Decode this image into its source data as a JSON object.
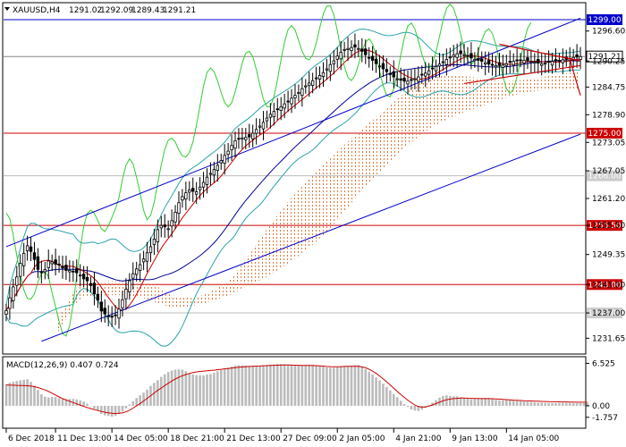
{
  "chart_data": {
    "type": "candlestick",
    "symbol": "XAUUSD,H4",
    "ohlc_header": {
      "open": "1291.02",
      "high": "1292.09",
      "low": "1289.43",
      "close": "1291.21"
    },
    "price_axis": {
      "ylim": [
        1228.5,
        1302.4
      ],
      "tick_labels": [
        "1296.60",
        "1290.25",
        "1284.75",
        "1278.90",
        "1273.05",
        "1267.05",
        "1261.20",
        "1255.50",
        "1249.35",
        "1243.00",
        "1237.00",
        "1231.65"
      ],
      "tick_values": [
        1296.6,
        1290.25,
        1284.75,
        1278.9,
        1273.05,
        1267.05,
        1261.2,
        1255.5,
        1249.35,
        1243.0,
        1237.0,
        1231.65
      ]
    },
    "x_axis": {
      "tick_labels": [
        "6 Dec 2018",
        "11 Dec 13:00",
        "14 Dec 05:00",
        "18 Dec 21:00",
        "21 Dec 13:00",
        "27 Dec 09:00",
        "2 Jan 05:00",
        "4 Jan 21:00",
        "9 Jan 13:00",
        "14 Jan 05:00"
      ],
      "tick_bar_index": [
        0,
        14,
        30,
        46,
        62,
        78,
        94,
        110,
        126,
        142
      ]
    },
    "levels": [
      {
        "label": "1299.00",
        "value": 1299.0,
        "color": "#0000cc",
        "style": "solid"
      },
      {
        "label": "1291.21",
        "value": 1291.21,
        "color": "#888888",
        "style": "solid"
      },
      {
        "label": "1275.00",
        "value": 1275.0,
        "color": "#cc0000",
        "style": "solid"
      },
      {
        "label": "1266.00",
        "value": 1266.0,
        "color": "#bbbbbb",
        "style": "solid"
      },
      {
        "label": "1255.50",
        "value": 1255.5,
        "color": "#cc0000",
        "style": "solid"
      },
      {
        "label": "1243.00",
        "value": 1243.0,
        "color": "#cc0000",
        "style": "solid"
      },
      {
        "label": "1237.00",
        "value": 1237.0,
        "color": "#bbbbbb",
        "style": "solid"
      }
    ],
    "channel": {
      "color": "#0000cc",
      "upper": {
        "x": [
          0,
          163
        ],
        "y": [
          1251.0,
          1299.3
        ]
      },
      "lower": {
        "x": [
          10,
          163
        ],
        "y": [
          1231.0,
          1274.8
        ]
      }
    },
    "triangle": {
      "color": "#cc0000",
      "upper": {
        "x": [
          140,
          163
        ],
        "y": [
          1293.8,
          1290.3
        ]
      },
      "lower": {
        "x": [
          130,
          163
        ],
        "y": [
          1285.5,
          1289.3
        ]
      },
      "projection": {
        "x": [
          160,
          163
        ],
        "y": [
          1290.6,
          1283.0
        ]
      }
    },
    "candles": {
      "count": 164,
      "up_color": "#000000",
      "down_color": "#000000",
      "close": [
        1237.5,
        1240.2,
        1242.5,
        1244.6,
        1247.5,
        1249.6,
        1251.2,
        1250.0,
        1248.3,
        1246.2,
        1245.6,
        1246.2,
        1248.0,
        1247.8,
        1247.3,
        1247.3,
        1246.5,
        1246.0,
        1246.0,
        1245.8,
        1245.5,
        1245.0,
        1244.2,
        1243.8,
        1242.8,
        1241.0,
        1239.7,
        1237.4,
        1236.8,
        1236.4,
        1236.1,
        1236.5,
        1237.8,
        1239.8,
        1242.0,
        1243.8,
        1245.3,
        1246.3,
        1247.2,
        1248.4,
        1249.7,
        1251.0,
        1252.6,
        1254.6,
        1255.5,
        1255.2,
        1254.8,
        1256.5,
        1258.3,
        1260.3,
        1261.6,
        1262.4,
        1263.0,
        1262.7,
        1262.6,
        1263.6,
        1264.6,
        1265.7,
        1266.5,
        1267.3,
        1268.2,
        1269.2,
        1270.3,
        1271.2,
        1272.4,
        1273.4,
        1273.9,
        1274.0,
        1274.1,
        1274.2,
        1275.0,
        1275.8,
        1276.5,
        1277.3,
        1278.2,
        1279.0,
        1279.6,
        1280.0,
        1280.6,
        1281.2,
        1281.7,
        1282.4,
        1283.0,
        1283.6,
        1284.4,
        1285.0,
        1285.6,
        1286.1,
        1286.7,
        1287.2,
        1287.8,
        1288.6,
        1289.5,
        1290.3,
        1291.3,
        1292.1,
        1292.7,
        1292.9,
        1293.1,
        1293.2,
        1292.9,
        1292.3,
        1291.6,
        1291.0,
        1290.4,
        1289.7,
        1289.2,
        1288.6,
        1288.0,
        1287.4,
        1286.9,
        1286.5,
        1286.2,
        1286.0,
        1286.0,
        1286.2,
        1286.5,
        1286.9,
        1287.3,
        1287.7,
        1288.2,
        1288.7,
        1289.1,
        1289.6,
        1290.1,
        1290.6,
        1291.1,
        1291.5,
        1291.8,
        1291.8,
        1291.6,
        1291.3,
        1290.9,
        1290.6,
        1290.4,
        1290.2,
        1289.9,
        1289.6,
        1289.4,
        1289.3,
        1289.3,
        1289.4,
        1289.7,
        1290.0,
        1290.2,
        1290.3,
        1290.4,
        1290.4,
        1290.3,
        1290.2,
        1290.0,
        1289.8,
        1289.7,
        1289.8,
        1290.0,
        1290.2,
        1290.3,
        1290.4,
        1290.5,
        1290.6,
        1290.8,
        1291.0,
        1291.1,
        1291.2
      ]
    },
    "indicators": {
      "ma_fast": {
        "color": "#cc0000"
      },
      "ma_slow": {
        "color": "#000099"
      },
      "bollinger": {
        "color": "#2aa3a8"
      },
      "chikou": {
        "color": "#33cc33"
      },
      "ichimoku_cloud": {
        "color": "#e07a3c"
      }
    },
    "macd": {
      "label": "MACD(12,26,9) 0.407 0.724",
      "params": [
        12,
        26,
        9
      ],
      "macd_value": 0.407,
      "signal_value": 0.724,
      "ylim": [
        -3.3,
        7.4
      ],
      "tick_labels": [
        "6.525",
        "0.00",
        "-1.757"
      ],
      "tick_values": [
        6.525,
        0.0,
        -1.757
      ],
      "histogram_color": "#bbbbbb",
      "signal_color": "#cc0000",
      "histogram": [
        3.32,
        3.55,
        3.69,
        3.8,
        3.91,
        4.0,
        4.07,
        3.67,
        3.1,
        2.44,
        1.77,
        1.41,
        1.29,
        1.37,
        1.34,
        1.16,
        1.04,
        1.0,
        1.06,
        1.06,
        0.98,
        0.83,
        0.64,
        0.34,
        -0.01,
        -0.46,
        -0.75,
        -1.23,
        -1.47,
        -1.55,
        -1.65,
        -1.55,
        -1.26,
        -0.86,
        -0.4,
        0.2,
        0.7,
        1.2,
        1.61,
        2.02,
        2.48,
        3.05,
        3.52,
        3.93,
        4.44,
        4.85,
        5.19,
        5.41,
        5.55,
        5.58,
        5.55,
        5.33,
        5.02,
        4.8,
        4.7,
        4.69,
        4.67,
        4.79,
        4.88,
        5.07,
        5.31,
        5.51,
        5.74,
        5.86,
        6.02,
        6.18,
        6.25,
        6.23,
        6.18,
        6.12,
        6.12,
        6.15,
        6.12,
        6.23,
        6.29,
        6.31,
        6.33,
        6.41,
        6.41,
        6.4,
        6.33,
        6.27,
        6.25,
        6.21,
        6.22,
        6.24,
        6.27,
        6.28,
        6.22,
        6.15,
        6.01,
        5.89,
        5.84,
        5.84,
        5.91,
        6.07,
        6.08,
        6.08,
        6.16,
        6.23,
        6.25,
        6.01,
        5.63,
        5.24,
        4.84,
        4.35,
        3.9,
        3.41,
        2.89,
        2.37,
        1.82,
        1.33,
        0.78,
        0.29,
        -0.17,
        -0.55,
        -0.73,
        -0.79,
        -0.61,
        -0.29,
        0.13,
        0.49,
        0.88,
        1.25,
        1.5,
        1.6,
        1.52,
        1.46,
        1.44,
        1.32,
        1.2,
        1.1,
        1.0,
        1.04,
        1.14,
        1.18,
        1.22,
        1.2,
        1.05,
        0.92,
        0.85,
        0.83,
        0.87,
        0.86,
        0.79,
        0.76,
        0.71,
        0.67,
        0.62,
        0.58,
        0.53,
        0.5,
        0.48,
        0.45,
        0.43,
        0.41,
        0.41,
        0.43,
        0.44,
        0.45,
        0.44,
        0.41,
        0.41,
        0.42,
        0.41,
        0.41
      ],
      "signal": [
        3.2,
        3.18,
        3.16,
        3.14,
        3.12,
        3.1,
        3.08,
        3.02,
        2.94,
        2.8,
        2.62,
        2.43,
        2.22,
        1.94,
        1.65,
        1.36,
        1.11,
        0.9,
        0.7,
        0.5,
        0.31,
        0.12,
        -0.07,
        -0.25,
        -0.42,
        -0.58,
        -0.72,
        -0.86,
        -0.98,
        -1.08,
        -1.15,
        -1.18,
        -1.15,
        -1.07,
        -0.92,
        -0.67,
        -0.35,
        0.0,
        0.35,
        0.75,
        1.15,
        1.55,
        1.97,
        2.36,
        2.72,
        3.1,
        3.46,
        3.8,
        4.11,
        4.4,
        4.62,
        4.81,
        4.96,
        5.1,
        5.2,
        5.28,
        5.33,
        5.38,
        5.42,
        5.47,
        5.55,
        5.6,
        5.68,
        5.73,
        5.79,
        5.85,
        5.92,
        5.96,
        6.01,
        6.04,
        6.07,
        6.09,
        6.11,
        6.15,
        6.17,
        6.2,
        6.22,
        6.24,
        6.25,
        6.26,
        6.26,
        6.25,
        6.24,
        6.22,
        6.21,
        6.2,
        6.19,
        6.18,
        6.16,
        6.12,
        6.08,
        6.04,
        6.02,
        6.0,
        6.0,
        6.02,
        6.04,
        6.05,
        6.06,
        6.07,
        6.05,
        5.97,
        5.83,
        5.6,
        5.32,
        4.98,
        4.58,
        4.14,
        3.68,
        3.2,
        2.7,
        2.22,
        1.75,
        1.3,
        0.87,
        0.48,
        0.12,
        -0.12,
        -0.2,
        -0.17,
        -0.04,
        0.13,
        0.35,
        0.56,
        0.76,
        0.92,
        1.04,
        1.1,
        1.15,
        1.18,
        1.18,
        1.16,
        1.14,
        1.13,
        1.12,
        1.11,
        1.11,
        1.11,
        1.09,
        1.06,
        1.03,
        0.99,
        0.95,
        0.91,
        0.87,
        0.84,
        0.81,
        0.78,
        0.76,
        0.74,
        0.72,
        0.7,
        0.68,
        0.66,
        0.64,
        0.63,
        0.62,
        0.61,
        0.6,
        0.59,
        0.58,
        0.57,
        0.56,
        0.55,
        0.55,
        0.54
      ]
    }
  }
}
